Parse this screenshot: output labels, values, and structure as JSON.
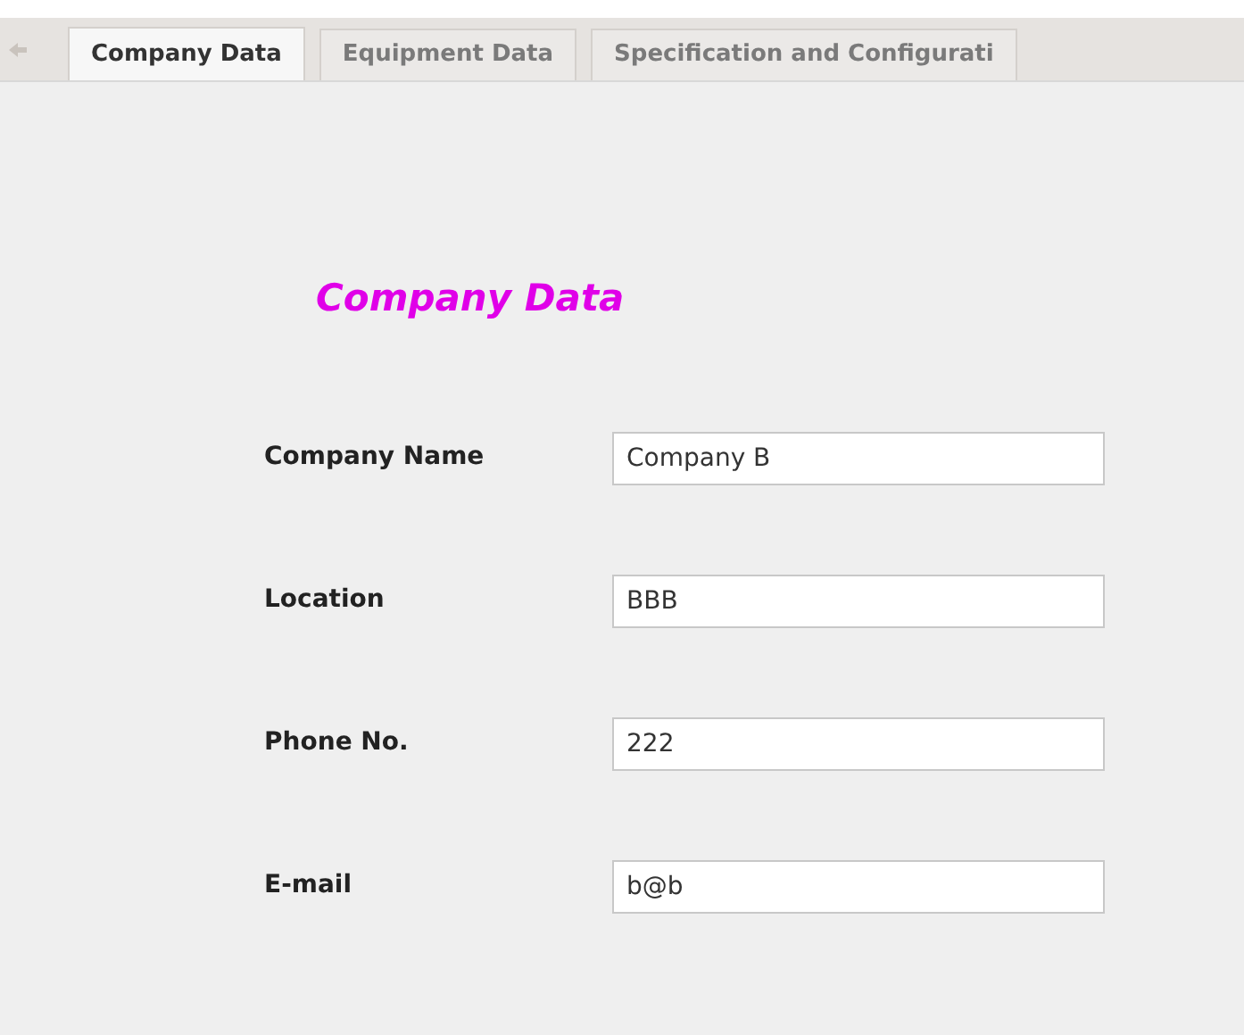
{
  "tabs": [
    {
      "label": "Company Data",
      "selected": true
    },
    {
      "label": "Equipment Data",
      "selected": false
    },
    {
      "label": "Specification and Configurati",
      "selected": false
    }
  ],
  "heading": "Company Data",
  "fields": [
    {
      "label": "Company Name",
      "value": "Company B"
    },
    {
      "label": "Location",
      "value": "BBB"
    },
    {
      "label": "Phone No.",
      "value": "222"
    },
    {
      "label": "E-mail",
      "value": "b@b"
    }
  ]
}
